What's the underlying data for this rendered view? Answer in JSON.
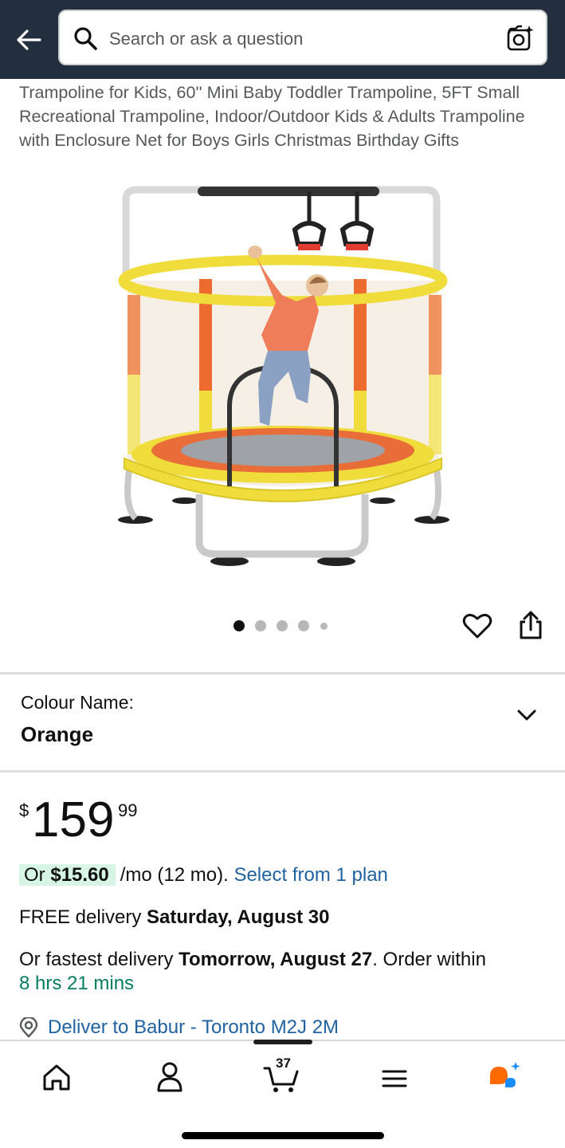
{
  "search": {
    "placeholder": "Search or ask a question"
  },
  "product": {
    "title": "Trampoline for Kids, 60'' Mini Baby Toddler Trampoline, 5FT Small Recreational Trampoline, Indoor/Outdoor Kids & Adults Trampoline with Enclosure Net for Boys Girls Christmas Birthday Gifts"
  },
  "image_carousel": {
    "count": 5,
    "active_index": 0
  },
  "colour": {
    "label": "Colour Name:",
    "value": "Orange"
  },
  "price": {
    "currency": "$",
    "whole": "159",
    "fraction": "99"
  },
  "finance": {
    "prefix": "Or",
    "monthly": "$15.60",
    "suffix": "/mo (12 mo).",
    "link": "Select from 1 plan"
  },
  "delivery": {
    "free_prefix": "FREE delivery",
    "free_date": "Saturday, August 30",
    "fast_prefix": "Or fastest delivery",
    "fast_date": "Tomorrow, August 27",
    "fast_mid": ". Order within",
    "countdown": "8 hrs 21 mins"
  },
  "deliver_to": {
    "text": "Deliver to Babur - Toronto M2J 2M"
  },
  "nav": {
    "cart_count": "37"
  },
  "colors": {
    "header_bg": "#232f3e",
    "link": "#2162a1",
    "green": "#067d62",
    "finance_pill": "#d7f5e4",
    "rufus_orange": "#ff6a00",
    "rufus_blue": "#1a8cff"
  },
  "icons": [
    "back-arrow-icon",
    "search-icon",
    "camera-lens-icon",
    "heart-icon",
    "share-icon",
    "chevron-down-icon",
    "location-pin-icon",
    "home-icon",
    "account-icon",
    "cart-icon",
    "menu-icon",
    "rufus-icon"
  ]
}
